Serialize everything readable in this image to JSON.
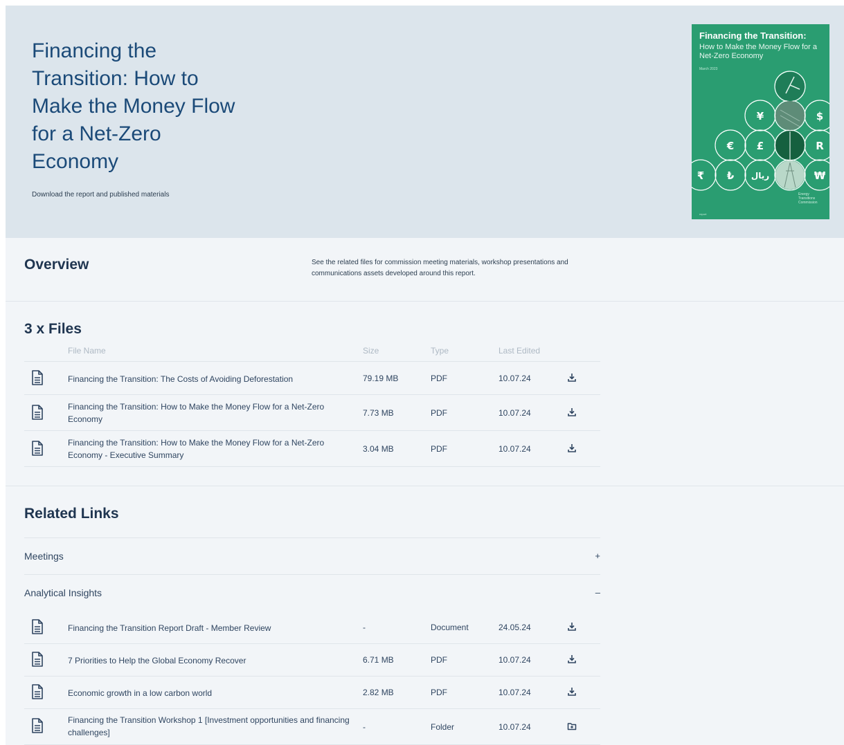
{
  "hero": {
    "title": "Financing the Transition: How to Make the Money Flow for a Net-Zero Economy",
    "subtitle": "Download the report and published materials"
  },
  "cover": {
    "title_line1": "Financing the Transition:",
    "title_line2": "How to Make the Money Flow for a Net-Zero Economy",
    "date": "March 2023",
    "publisher": "Energy Transitions Commission",
    "footer": "report",
    "currency_symbols": [
      "¥",
      "$",
      "€",
      "£",
      "R",
      "₹",
      "₺",
      "ريال",
      "₩"
    ],
    "bg_color": "#2a9d71"
  },
  "overview": {
    "title": "Overview",
    "text": "See the related files for commission meeting materials, workshop presentations and communications assets developed around this report."
  },
  "files": {
    "title": "3 x Files",
    "columns": {
      "name": "File Name",
      "size": "Size",
      "type": "Type",
      "edited": "Last Edited"
    },
    "rows": [
      {
        "name": "Financing the Transition: The Costs of Avoiding Deforestation",
        "size": "79.19 MB",
        "type": "PDF",
        "edited": "10.07.24",
        "icon": "file-icon",
        "action": "download-icon"
      },
      {
        "name": "Financing the Transition: How to Make the Money Flow for a Net-Zero Economy",
        "size": "7.73 MB",
        "type": "PDF",
        "edited": "10.07.24",
        "icon": "file-icon",
        "action": "download-icon"
      },
      {
        "name": "Financing the Transition: How to Make the Money Flow for a Net-Zero Economy - Executive Summary",
        "size": "3.04 MB",
        "type": "PDF",
        "edited": "10.07.24",
        "icon": "file-icon",
        "action": "download-icon"
      }
    ]
  },
  "related": {
    "title": "Related Links",
    "sections": [
      {
        "label": "Meetings",
        "sign": "+"
      },
      {
        "label": "Analytical Insights",
        "sign": "–"
      }
    ],
    "rows": [
      {
        "name": "Financing the Transition Report Draft - Member Review",
        "size": "-",
        "type": "Document",
        "edited": "24.05.24",
        "icon": "file-icon",
        "action": "download-icon"
      },
      {
        "name": "7 Priorities to Help the Global Economy Recover",
        "size": "6.71 MB",
        "type": "PDF",
        "edited": "10.07.24",
        "icon": "file-icon",
        "action": "download-icon"
      },
      {
        "name": "Economic growth in a low carbon world",
        "size": "2.82 MB",
        "type": "PDF",
        "edited": "10.07.24",
        "icon": "file-icon",
        "action": "download-icon"
      },
      {
        "name": "Financing the Transition Workshop 1 [Investment opportunities and financing challenges]",
        "size": "-",
        "type": "Folder",
        "edited": "10.07.24",
        "icon": "file-icon",
        "action": "folder-icon"
      }
    ]
  }
}
